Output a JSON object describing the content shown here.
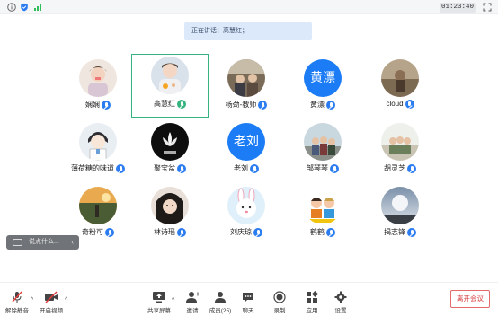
{
  "topbar": {
    "timer": "01:23:40"
  },
  "speaking_banner": "正在讲话：高慧红；",
  "participants": [
    {
      "name": "娴娴",
      "avatar_text": ""
    },
    {
      "name": "高慧红",
      "avatar_text": ""
    },
    {
      "name": "杨劲-教师",
      "avatar_text": ""
    },
    {
      "name": "黄漂",
      "avatar_text": "黄漂"
    },
    {
      "name": "cloud",
      "avatar_text": ""
    },
    {
      "name": "薄荷糖的味道",
      "avatar_text": ""
    },
    {
      "name": "聚宝盆",
      "avatar_text": ""
    },
    {
      "name": "老刘",
      "avatar_text": "老刘"
    },
    {
      "name": "邹琴琴",
      "avatar_text": ""
    },
    {
      "name": "胡灵芝",
      "avatar_text": ""
    },
    {
      "name": "奇粉可",
      "avatar_text": ""
    },
    {
      "name": "林诗瑶",
      "avatar_text": ""
    },
    {
      "name": "刘庆琼",
      "avatar_text": ""
    },
    {
      "name": "鹤鹤",
      "avatar_text": ""
    },
    {
      "name": "揭志锋",
      "avatar_text": ""
    }
  ],
  "chat_input": {
    "placeholder": "说点什么..."
  },
  "toolbar": {
    "unmute": "解除静音",
    "video": "开启视频",
    "share": "共享屏幕",
    "invite": "邀请",
    "members": "成员(25)",
    "chat": "聊天",
    "record": "录制",
    "apps": "应用",
    "settings": "设置",
    "leave": "离开会议"
  },
  "colors": {
    "accent": "#1b7cf5",
    "active_border": "#35b37e",
    "leave": "#d64040"
  }
}
